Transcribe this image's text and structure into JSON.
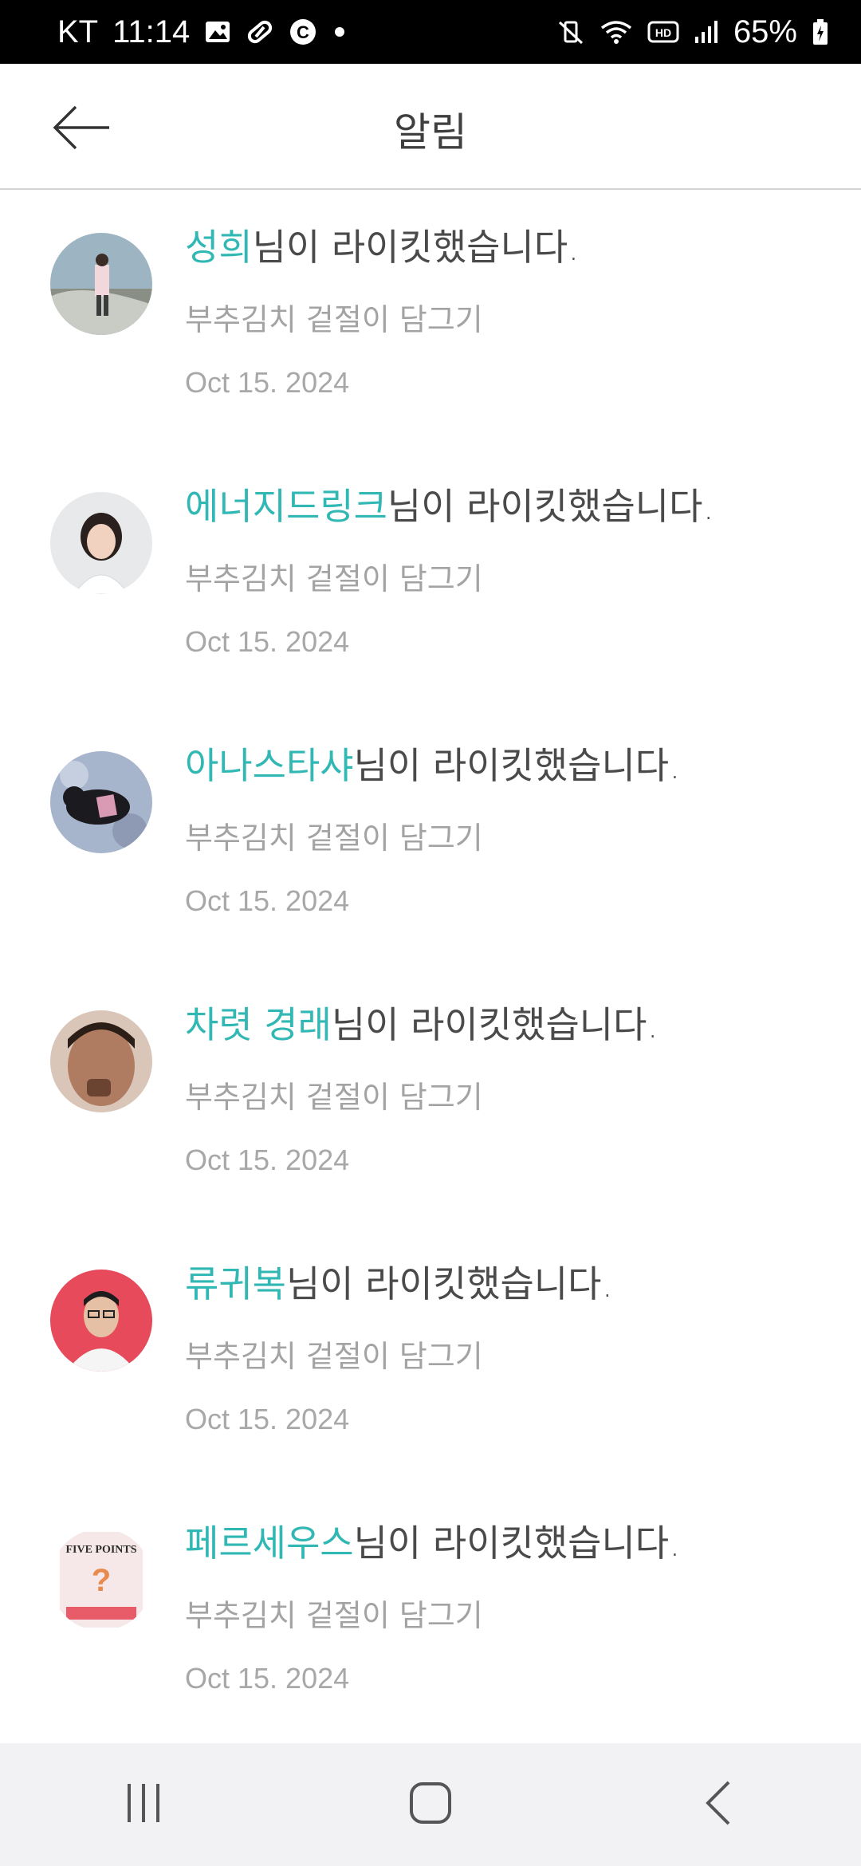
{
  "status_bar": {
    "carrier": "KT",
    "time": "11:14",
    "battery": "65%",
    "left_icons": [
      "gallery-icon",
      "pill-icon",
      "c-icon",
      "dot-icon"
    ],
    "right_icons": [
      "mute-vibrate-icon",
      "wifi-icon",
      "hd-icon",
      "signal-icon",
      "battery-icon"
    ]
  },
  "header": {
    "title": "알림",
    "back_icon": "arrow-left-icon"
  },
  "notifications": [
    {
      "user": "성희",
      "suffix": "님이 라이킷했습니다.",
      "post": "부추김치 겉절이 담그기",
      "date": "Oct 15. 2024",
      "avatar_color": "#8fa7b5"
    },
    {
      "user": "에너지드링크",
      "suffix": "님이 라이킷했습니다.",
      "post": "부추김치 겉절이 담그기",
      "date": "Oct 15. 2024",
      "avatar_color": "#e6e8ea"
    },
    {
      "user": "아나스타샤",
      "suffix": "님이 라이킷했습니다.",
      "post": "부추김치 겉절이 담그기",
      "date": "Oct 15. 2024",
      "avatar_color": "#9aa7c0"
    },
    {
      "user": "차렷 경래",
      "suffix": "님이 라이킷했습니다.",
      "post": "부추김치 겉절이 담그기",
      "date": "Oct 15. 2024",
      "avatar_color": "#c09a86"
    },
    {
      "user": "류귀복",
      "suffix": "님이 라이킷했습니다.",
      "post": "부추김치 겉절이 담그기",
      "date": "Oct 15. 2024",
      "avatar_color": "#e64a5b"
    },
    {
      "user": "페르세우스",
      "suffix": "님이 라이킷했습니다.",
      "post": "부추김치 겉절이 담그기",
      "date": "Oct 15. 2024",
      "avatar_color": "#f6e7e8",
      "avatar_caption": "FIVE POINTS"
    }
  ],
  "nav_bar": {
    "items": [
      "recent-apps-icon",
      "home-icon",
      "back-icon"
    ]
  },
  "colors": {
    "accent": "#31b8b4",
    "text": "#4a4a4a",
    "muted": "#a3a3a3"
  }
}
